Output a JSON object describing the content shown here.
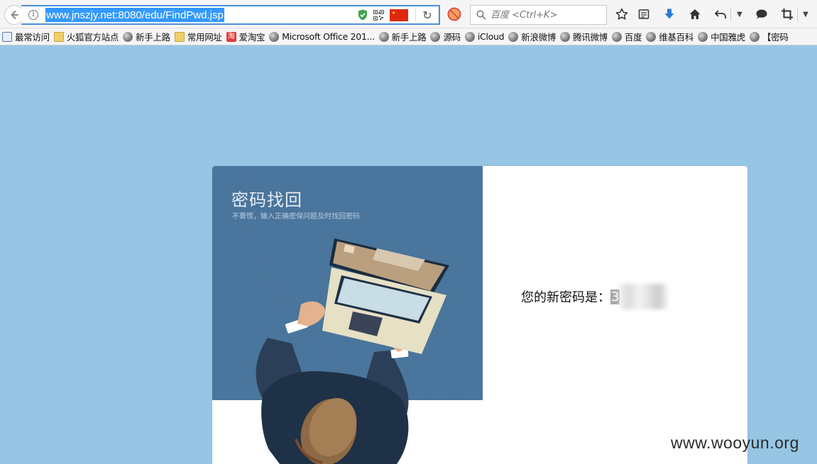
{
  "browser": {
    "url": "www.jnszjy.net:8080/edu/FindPwd.jsp",
    "search_placeholder": "百度 <Ctrl+K>",
    "colors": {
      "url_highlight": "#3399ff",
      "urlbar_border": "#4a90d9",
      "download_arrow": "#2a7bdc"
    }
  },
  "bookmarks": [
    {
      "label": "最常访问",
      "icon": "frequent-icon"
    },
    {
      "label": "火狐官方站点",
      "icon": "folder-icon"
    },
    {
      "label": "新手上路",
      "icon": "globe-icon"
    },
    {
      "label": "常用网址",
      "icon": "folder-icon"
    },
    {
      "label": "爱淘宝",
      "icon": "taobao-icon",
      "icon_char": "淘"
    },
    {
      "label": "Microsoft Office 201...",
      "icon": "globe-icon"
    },
    {
      "label": "新手上路",
      "icon": "globe-icon"
    },
    {
      "label": "源码",
      "icon": "globe-icon"
    },
    {
      "label": "iCloud",
      "icon": "globe-icon"
    },
    {
      "label": "新浪微博",
      "icon": "globe-icon"
    },
    {
      "label": "腾讯微博",
      "icon": "globe-icon"
    },
    {
      "label": "百度",
      "icon": "globe-icon"
    },
    {
      "label": "维基百科",
      "icon": "globe-icon"
    },
    {
      "label": "中国雅虎",
      "icon": "globe-icon"
    },
    {
      "label": "【密码",
      "icon": "globe-icon"
    }
  ],
  "page": {
    "title": "密码找回",
    "subtitle": "不要慌，输入正确密保问题及时找回密码",
    "result_label": "您的新密码是：",
    "result_value": "3",
    "colors": {
      "background": "#97c6e5",
      "panel_blue": "#4a759c"
    }
  },
  "watermark": "www.wooyun.org"
}
